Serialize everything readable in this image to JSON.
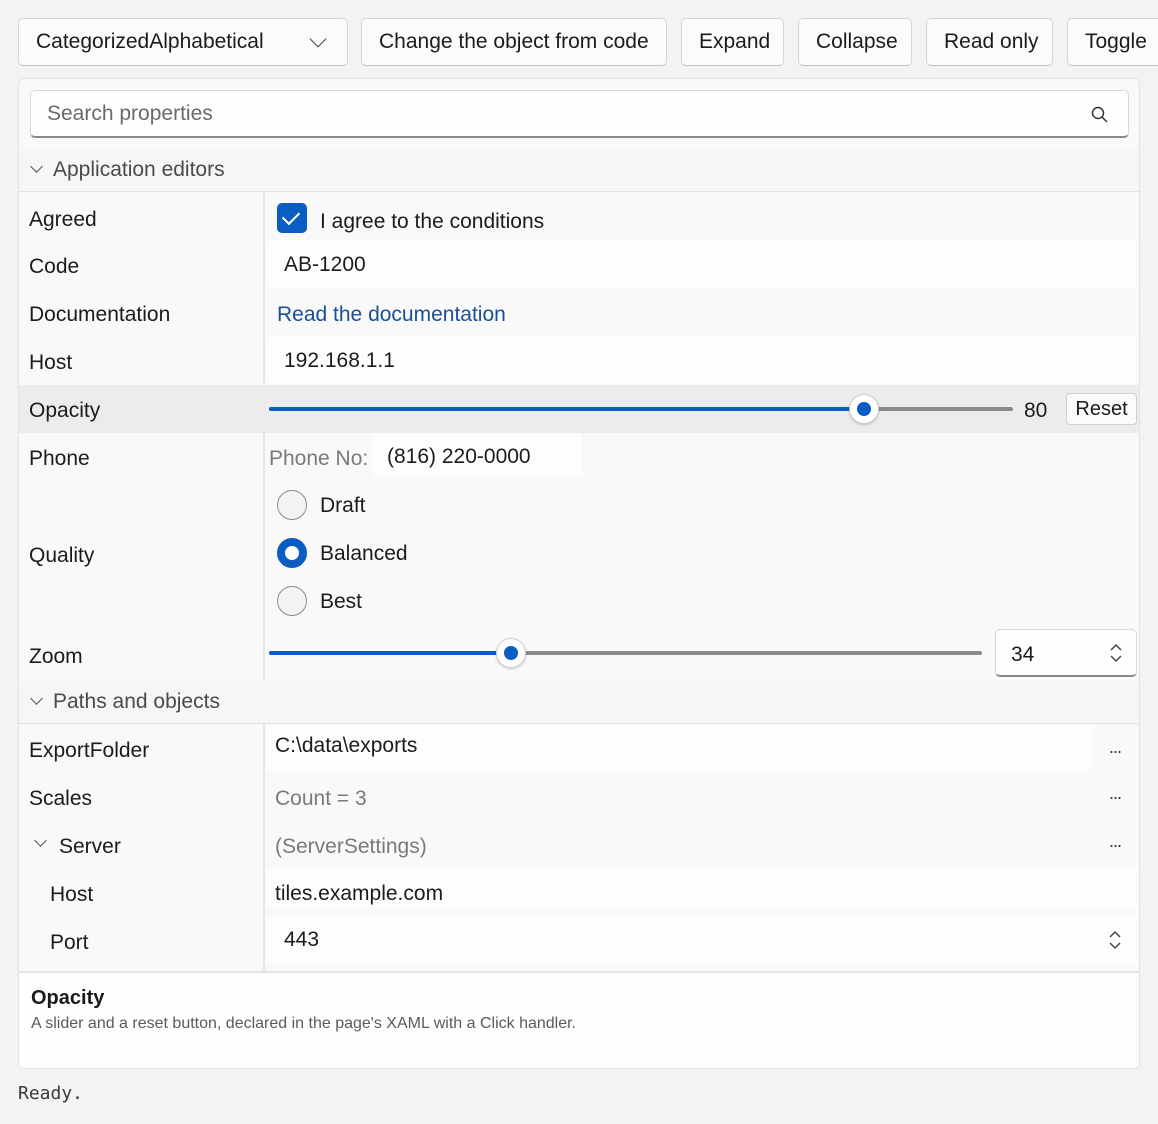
{
  "toolbar": {
    "sort_mode": "CategorizedAlphabetical",
    "change_object": "Change the object from code",
    "expand": "Expand",
    "collapse": "Collapse",
    "read_only": "Read only",
    "toggle": "Toggle"
  },
  "search": {
    "placeholder": "Search properties"
  },
  "categories": {
    "app_editors": "Application editors",
    "paths_objects": "Paths and objects"
  },
  "properties": {
    "agreed": {
      "name": "Agreed",
      "checked": true,
      "text": "I agree to the conditions"
    },
    "code": {
      "name": "Code",
      "value": "AB-1200"
    },
    "documentation": {
      "name": "Documentation",
      "link": "Read the documentation"
    },
    "host": {
      "name": "Host",
      "value": "192.168.1.1"
    },
    "opacity": {
      "name": "Opacity",
      "value": "80",
      "level": 80,
      "min": 0,
      "max": 100,
      "reset": "Reset"
    },
    "phone": {
      "name": "Phone",
      "label": "Phone No:",
      "value": "(816) 220-0000"
    },
    "quality": {
      "name": "Quality",
      "options": [
        "Draft",
        "Balanced",
        "Best"
      ],
      "selected": "Balanced"
    },
    "zoom": {
      "name": "Zoom",
      "value": "34",
      "level": 34,
      "min": 0,
      "max": 100
    },
    "export_folder": {
      "name": "ExportFolder",
      "value": "C:\\data\\exports",
      "more": "..."
    },
    "scales": {
      "name": "Scales",
      "value": "Count = 3",
      "more": "..."
    },
    "server": {
      "name": "Server",
      "value": "(ServerSettings)",
      "more": "..."
    },
    "server_host": {
      "name": "Host",
      "value": "tiles.example.com"
    },
    "server_port": {
      "name": "Port",
      "value": "443"
    }
  },
  "description": {
    "title": "Opacity",
    "text": "A slider and a reset button, declared in the page's XAML with a Click handler."
  },
  "status": "Ready.",
  "colors": {
    "accent": "#0a5dc2",
    "link": "#1a4f96"
  }
}
